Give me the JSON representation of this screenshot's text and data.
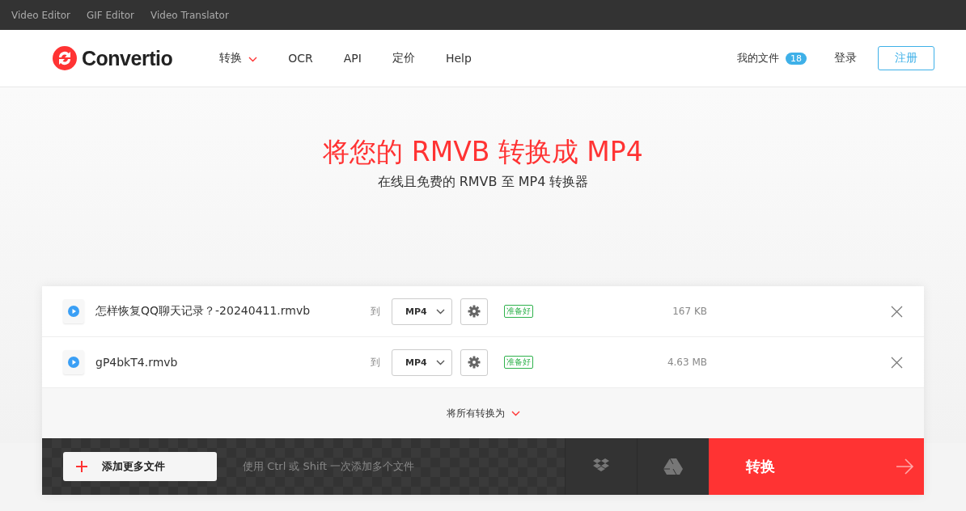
{
  "top_links": [
    "Video Editor",
    "GIF Editor",
    "Video Translator"
  ],
  "logo": "Convertio",
  "nav": [
    {
      "label": "转换",
      "dropdown": true
    },
    {
      "label": "OCR",
      "dropdown": false
    },
    {
      "label": "API",
      "dropdown": false
    },
    {
      "label": "定价",
      "dropdown": false
    },
    {
      "label": "Help",
      "dropdown": false
    }
  ],
  "account": {
    "files_label": "我的文件",
    "files_count": "18",
    "login": "登录",
    "signup": "注册"
  },
  "hero": {
    "title": "将您的 RMVB 转换成 MP4",
    "subtitle": "在线且免费的 RMVB 至 MP4 转换器"
  },
  "files": [
    {
      "name": "怎样恢复QQ聊天记录？-20240411.rmvb",
      "to": "到",
      "format": "MP4",
      "status": "准备好",
      "size": "167 KB"
    },
    {
      "name": "gP4bkT4.rmvb",
      "to": "到",
      "format": "MP4",
      "status": "准备好",
      "size": "4.63 MB"
    }
  ],
  "convert_all": "将所有转换为",
  "bottom": {
    "add_button": "添加更多文件",
    "hint": "使用 Ctrl 或 Shift 一次添加多个文件",
    "convert_button": "转换"
  }
}
